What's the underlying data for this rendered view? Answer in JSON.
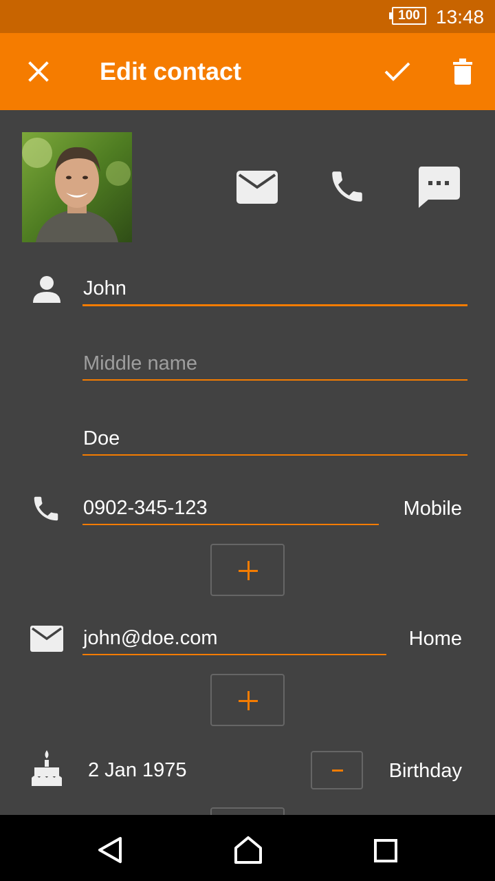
{
  "status_bar": {
    "battery": "100",
    "time": "13:48"
  },
  "app_bar": {
    "title": "Edit contact",
    "close_icon": "close-icon",
    "save_icon": "check-icon",
    "delete_icon": "trash-icon"
  },
  "header_actions": {
    "photo": "contact-photo",
    "icons": [
      "email-icon",
      "phone-icon",
      "sms-icon"
    ]
  },
  "name": {
    "first": "John",
    "middle_placeholder": "Middle name",
    "last": "Doe"
  },
  "phone": {
    "number": "0902-345-123",
    "type": "Mobile"
  },
  "email": {
    "address": "john@doe.com",
    "type": "Home"
  },
  "event": {
    "date": "2 Jan 1975",
    "type": "Birthday"
  },
  "colors": {
    "accent": "#f57c00",
    "status_bar": "#c86400",
    "background": "#424242",
    "nav_bar": "#000000"
  },
  "nav_bar": {
    "icons": [
      "back-icon",
      "home-icon",
      "recents-icon"
    ]
  }
}
